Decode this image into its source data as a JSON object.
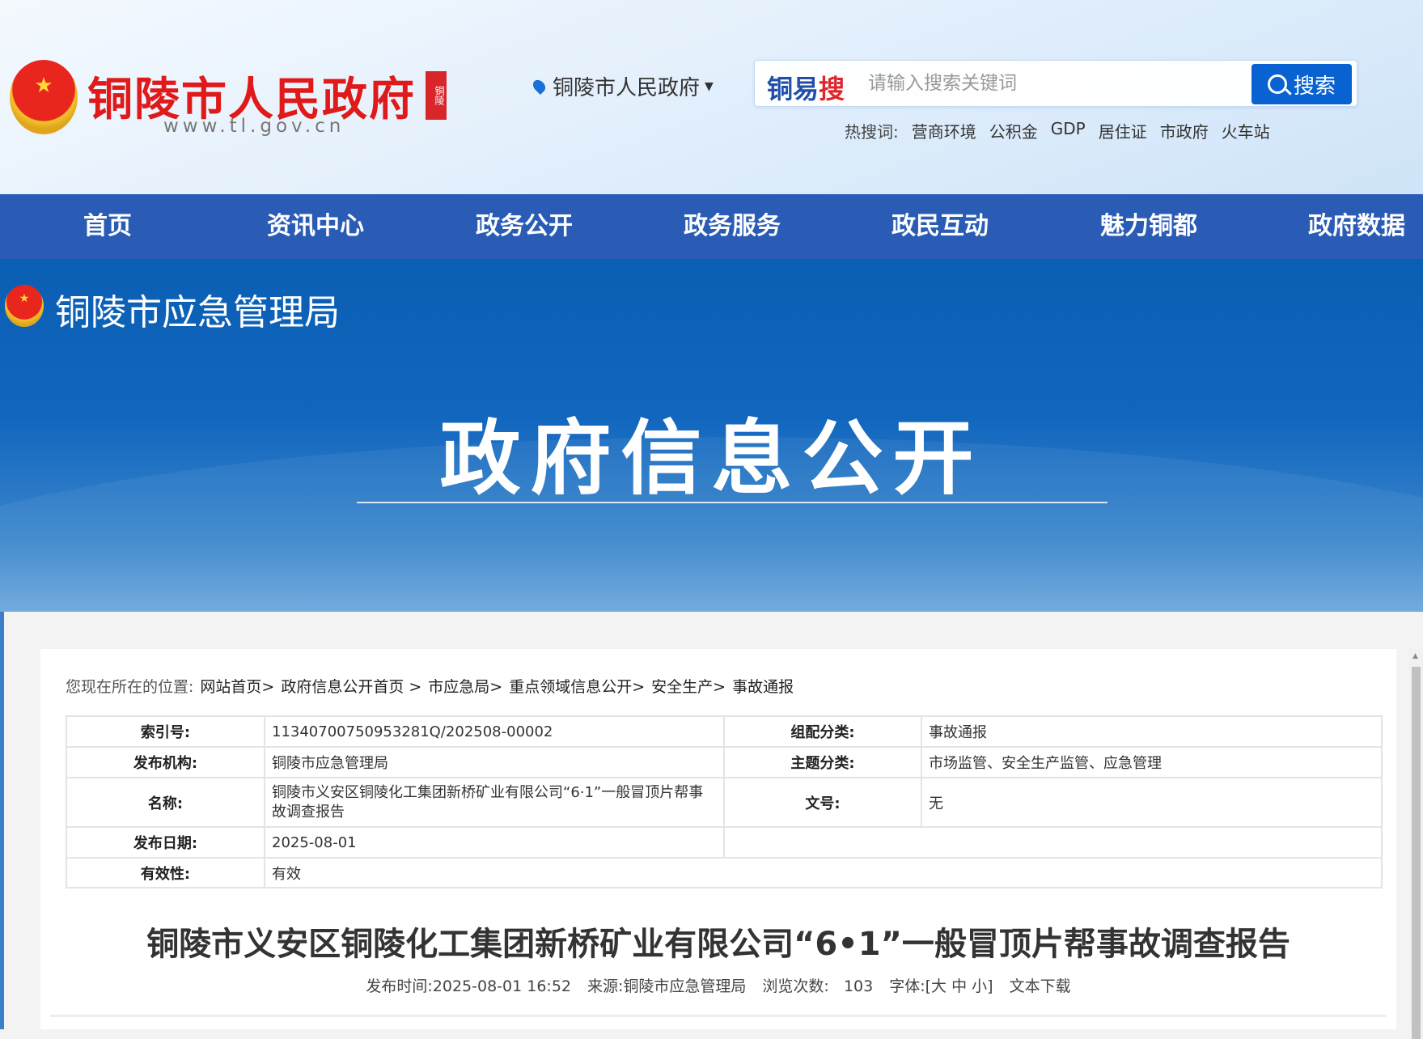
{
  "header": {
    "site_title": "铜陵市人民政府",
    "seal_text": "铜陵",
    "site_url": "www.tl.gov.cn",
    "location": "铜陵市人民政府",
    "search_brand_a": "铜易",
    "search_brand_b": "搜",
    "search_placeholder": "请输入搜索关键词",
    "search_button": "搜索",
    "hot_label": "热搜词:",
    "hot_words": [
      "营商环境",
      "公积金",
      "GDP",
      "居住证",
      "市政府",
      "火车站"
    ]
  },
  "nav": [
    "首页",
    "资讯中心",
    "政务公开",
    "政务服务",
    "政民互动",
    "魅力铜都",
    "政府数据"
  ],
  "banner": {
    "agency": "铜陵市应急管理局",
    "title": "政府信息公开"
  },
  "breadcrumb": {
    "label": "您现在所在的位置:",
    "items": [
      "网站首页>",
      "政府信息公开首页 >",
      "市应急局>",
      "重点领域信息公开>",
      "安全生产>",
      "事故通报"
    ]
  },
  "info": {
    "index_label": "索引号:",
    "index_value": "11340700750953281Q/202508-00002",
    "category_label": "组配分类:",
    "category_value": "事故通报",
    "org_label": "发布机构:",
    "org_value": "铜陵市应急管理局",
    "topic_label": "主题分类:",
    "topic_value": "市场监管、安全生产监管、应急管理",
    "name_label": "名称:",
    "name_value": "铜陵市义安区铜陵化工集团新桥矿业有限公司“6·1”一般冒顶片帮事故调查报告",
    "docno_label": "文号:",
    "docno_value": "无",
    "date_label": "发布日期:",
    "date_value": "2025-08-01",
    "valid_label": "有效性:",
    "valid_value": "有效"
  },
  "article": {
    "title": "铜陵市义安区铜陵化工集团新桥矿业有限公司“6•1”一般冒顶片帮事故调查报告",
    "publish": "发布时间:2025-08-01 16:52",
    "source": "来源:铜陵市应急管理局",
    "views_label": "浏览次数:",
    "views": "103",
    "font_label": "字体:[",
    "font_large": "大",
    "font_medium": "中",
    "font_small": "小",
    "font_end": "]",
    "download": "文本下载"
  }
}
